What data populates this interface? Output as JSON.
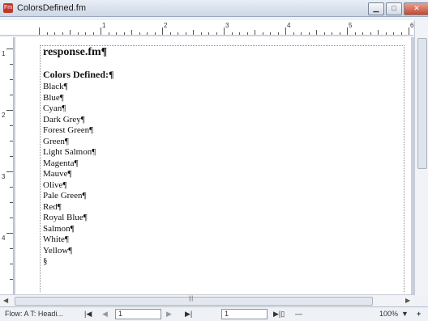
{
  "window": {
    "title": "ColorsDefined.fm",
    "app_icon_text": "Fm"
  },
  "ruler": {
    "numbers": [
      "1",
      "2",
      "3",
      "4",
      "5",
      "6"
    ],
    "vnumbers": [
      "1",
      "2",
      "3",
      "4"
    ]
  },
  "document": {
    "heading": "response.fm¶",
    "subheading": "Colors Defined:¶",
    "colors": [
      "Black¶",
      "Blue¶",
      "Cyan¶",
      "Dark Grey¶",
      "Forest Green¶",
      "Green¶",
      "Light Salmon¶",
      "Magenta¶",
      "Mauve¶",
      "Olive¶",
      "Pale Green¶",
      "Red¶",
      "Royal Blue¶",
      "Salmon¶",
      "White¶",
      "Yellow¶"
    ],
    "end_mark": "§"
  },
  "status": {
    "flow": "Flow: A  T: Headi...",
    "first": "|◀",
    "prev": "◀",
    "page_value": "1",
    "next": "▶",
    "last": "▶|",
    "page_count": "1",
    "zoom_out": "—",
    "zoom": "100%",
    "zoom_dropdown": "▼",
    "zoom_in": "+"
  },
  "scroll": {
    "thumb_label": "|||"
  }
}
